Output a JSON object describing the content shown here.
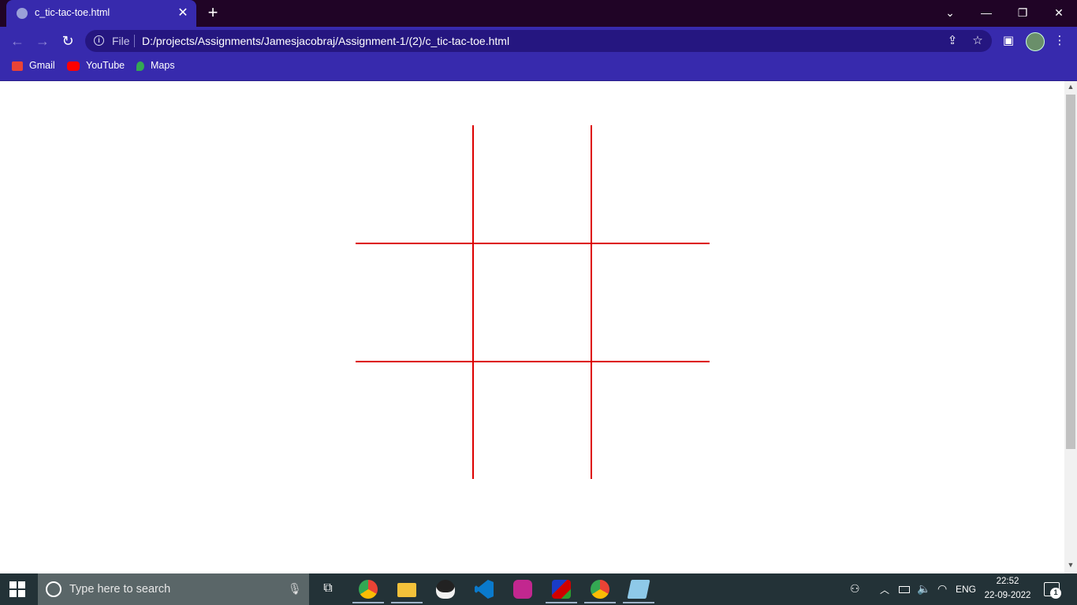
{
  "browser": {
    "tab": {
      "title": "c_tic-tac-toe.html",
      "close_glyph": "✕"
    },
    "new_tab_glyph": "+",
    "window_controls": {
      "tab_search_glyph": "⌄",
      "minimize_glyph": "—",
      "restore_glyph": "❐",
      "close_glyph": "✕"
    },
    "nav": {
      "back_glyph": "←",
      "forward_glyph": "→",
      "reload_glyph": "↻"
    },
    "address": {
      "scheme_label": "File",
      "url": "D:/projects/Assignments/Jamesjacobraj/Assignment-1/(2)/c_tic-tac-toe.html",
      "info_glyph": "i"
    },
    "toolbar_icons": {
      "share_glyph": "⇪",
      "star_glyph": "☆",
      "sidepanel_glyph": "▣",
      "menu_glyph": "⋮"
    },
    "bookmarks": [
      {
        "label": "Gmail",
        "icon": "gmail-icon",
        "color": "#ea4335"
      },
      {
        "label": "YouTube",
        "icon": "youtube-icon",
        "color": "#ff0000"
      },
      {
        "label": "Maps",
        "icon": "maps-icon",
        "color": "#34a853"
      }
    ],
    "accent_color": "#372aad",
    "tabstrip_color": "#200426"
  },
  "page": {
    "board": {
      "line_color": "#dd0000",
      "rows": 3,
      "columns": 3
    }
  },
  "taskbar": {
    "search_placeholder": "Type here to search",
    "apps": [
      {
        "name": "chrome-app",
        "color": "#4285f4"
      },
      {
        "name": "file-explorer-app",
        "color": "#f3c13a"
      },
      {
        "name": "penguin-app",
        "color": "#f0f0f0"
      },
      {
        "name": "vscode-app",
        "color": "#0a7acc"
      },
      {
        "name": "purple-app",
        "color": "#c2278f"
      },
      {
        "name": "dosbox-app",
        "color": "#d00000"
      },
      {
        "name": "chrome-profile-app",
        "color": "#4285f4"
      },
      {
        "name": "notepad-app",
        "color": "#8ec9e8"
      }
    ],
    "tray": {
      "language": "ENG",
      "time": "22:52",
      "date": "22-09-2022",
      "notification_count": "1"
    }
  }
}
